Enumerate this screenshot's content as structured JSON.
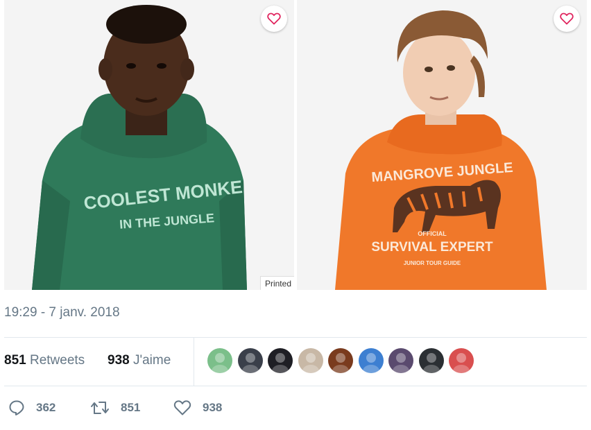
{
  "photos": {
    "left": {
      "hoodie_line1": "COOLEST MONKE",
      "hoodie_line2": "IN THE JUNGLE",
      "hoodie_color": "#2f7a5a",
      "favorite_icon": "heart-icon",
      "tag": "Printed"
    },
    "right": {
      "hoodie_line1": "MANGROVE JUNGLE",
      "hoodie_line2": "OFFICIAL",
      "hoodie_line3": "SURVIVAL EXPERT",
      "hoodie_line4": "JUNIOR TOUR GUIDE",
      "hoodie_color": "#f0782a",
      "favorite_icon": "heart-icon"
    }
  },
  "tweet": {
    "timestamp": "19:29 - 7 janv. 2018",
    "retweets_count": "851",
    "retweets_label": "Retweets",
    "likes_count": "938",
    "likes_label": "J'aime"
  },
  "avatars": [
    {
      "name": "avatar-1",
      "color": "#7bbf8a"
    },
    {
      "name": "avatar-2",
      "color": "#3a3f4a"
    },
    {
      "name": "avatar-3",
      "color": "#1e1e24"
    },
    {
      "name": "avatar-4",
      "color": "#c8b8a6"
    },
    {
      "name": "avatar-5",
      "color": "#7a3b1e"
    },
    {
      "name": "avatar-6",
      "color": "#3d7fd1"
    },
    {
      "name": "avatar-7",
      "color": "#5a4a6e"
    },
    {
      "name": "avatar-8",
      "color": "#2b2f33"
    },
    {
      "name": "avatar-9",
      "color": "#d94f4f"
    }
  ],
  "actions": {
    "reply": {
      "icon": "reply-icon",
      "count": "362"
    },
    "retweet": {
      "icon": "retweet-icon",
      "count": "851"
    },
    "like": {
      "icon": "like-icon",
      "count": "938"
    }
  },
  "colors": {
    "heart_accent": "#e0245e",
    "secondary_text": "#657786",
    "divider": "#e1e8ed"
  }
}
